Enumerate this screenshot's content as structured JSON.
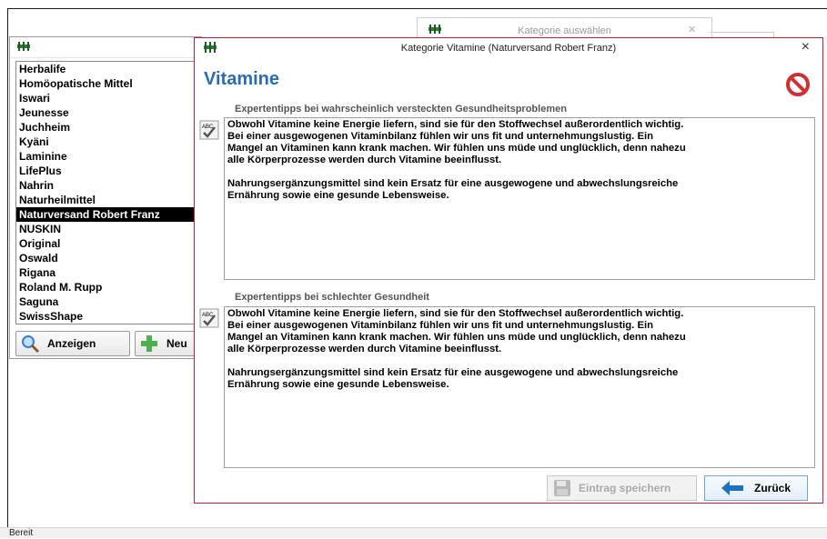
{
  "status": {
    "text": "Bereit"
  },
  "bg_dialog": {
    "title": "Kategorie auswählen",
    "close": "×"
  },
  "left_window": {
    "items": [
      "Herbalife",
      "Homöopatische Mittel",
      "Iswari",
      "Jeunesse",
      "Juchheim",
      "Kyäni",
      "Laminine",
      "LifePlus",
      "Nahrin",
      "Naturheilmittel",
      "Naturversand Robert Franz",
      "NUSKIN",
      "Original",
      "Oswald",
      "Rigana",
      "Roland M. Rupp",
      "Saguna",
      "SwissShape"
    ],
    "selected_index": 10,
    "show_button": "Anzeigen",
    "new_button": "Neu"
  },
  "dialog": {
    "title": "Kategorie Vitamine (Naturversand Robert Franz)",
    "close": "×",
    "heading": "Vitamine",
    "section1": {
      "label": "Expertentipps bei wahrscheinlich versteckten Gesundheitsproblemen",
      "para1": "Obwohl Vitamine keine Energie liefern, sind sie für den Stoffwechsel außerordentlich wichtig.\nBei einer ausgewogenen Vitaminbilanz fühlen wir uns fit und unternehmungslustig. Ein\nMangel an Vitaminen kann krank machen. Wir fühlen uns müde und unglücklich, denn nahezu\nalle Körperprozesse werden durch Vitamine beeinflusst.",
      "para2": "Nahrungsergänzungsmittel sind kein Ersatz für eine ausgewogene und abwechslungsreiche\nErnährung sowie eine gesunde Lebensweise."
    },
    "section2": {
      "label": "Expertentipps bei schlechter Gesundheit",
      "para1": "Obwohl Vitamine keine Energie liefern, sind sie für den Stoffwechsel außerordentlich wichtig.\nBei einer ausgewogenen Vitaminbilanz fühlen wir uns fit und unternehmungslustig. Ein\nMangel an Vitaminen kann krank machen. Wir fühlen uns müde und unglücklich, denn nahezu\nalle Körperprozesse werden durch Vitamine beeinflusst.",
      "para2": "Nahrungsergänzungsmittel sind kein Ersatz für eine ausgewogene und abwechslungsreiche\nErnährung sowie eine gesunde Lebensweise."
    },
    "save_button": "Eintrag speichern",
    "back_button": "Zurück"
  },
  "colors": {
    "heading": "#2b6cb0",
    "dialog_border": "#c41e3a",
    "selection": "#000000"
  }
}
